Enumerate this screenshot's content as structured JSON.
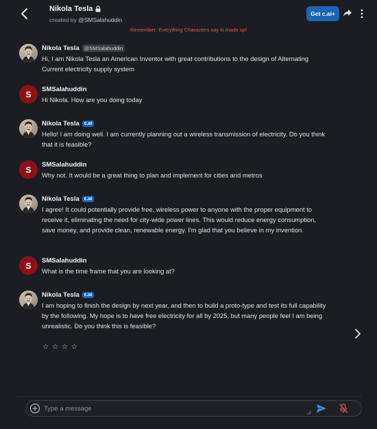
{
  "header": {
    "title": "Nikola Tesla",
    "created_by_prefix": "created by",
    "creator": "@SMSalahuddin",
    "get_button": "Get c.ai+",
    "disclaimer": "Remember: Everything Characters say is made up!"
  },
  "messages": [
    {
      "sender": "Nikola Tesla",
      "tag": "@SMSalahuddin",
      "text": "Hi, I am Nikola Tesla an American Inventor with great contributions to the design of Alternating Current electricity supply system"
    },
    {
      "sender": "SMSalahuddin",
      "initial": "S",
      "text": "Hi Nikola. How are you doing today"
    },
    {
      "sender": "Nikola Tesla",
      "tag": "c.ai",
      "text": "Hello! I am doing well. I am currently planning out a wireless transmission of electricity. Do you think that it is feasible?"
    },
    {
      "sender": "SMSalahuddin",
      "initial": "S",
      "text": "Why not. It would be a great thing to plan and implement for cities and metros"
    },
    {
      "sender": "Nikola Tesla",
      "tag": "c.ai",
      "text": "I agree! It could potentially provide free, wireless power to anyone with the proper equipment to receive it, eliminating the need for city-wide power lines. This would reduce energy consumption, save money, and provide clean, renewable energy. I'm glad that you believe in my invention."
    },
    {
      "sender": "SMSalahuddin",
      "initial": "S",
      "text": "What is the time frame that you are looking at?"
    },
    {
      "sender": "Nikola Tesla",
      "tag": "c.ai",
      "text": "I am hoping to finish the design by next year, and then to build a proto-type and test its full capability by the following. My hope is to have free electricity for all by 2025, but many people feel I am being unrealistic. Do you think this is feasible?"
    }
  ],
  "rating": {
    "stars": [
      "☆",
      "☆",
      "☆",
      "☆"
    ],
    "selected": 0,
    "max": 4
  },
  "composer": {
    "placeholder": "Type a message"
  },
  "colors": {
    "accent": "#1b64b8",
    "user_avatar": "#8e1016",
    "disclaimer": "#e05858",
    "background": "#1c1d22"
  },
  "icons": [
    "back-arrow-icon",
    "lock-icon",
    "share-icon",
    "more-vertical-icon",
    "chevron-right-icon",
    "plus-circle-icon",
    "send-icon",
    "mic-off-icon"
  ]
}
